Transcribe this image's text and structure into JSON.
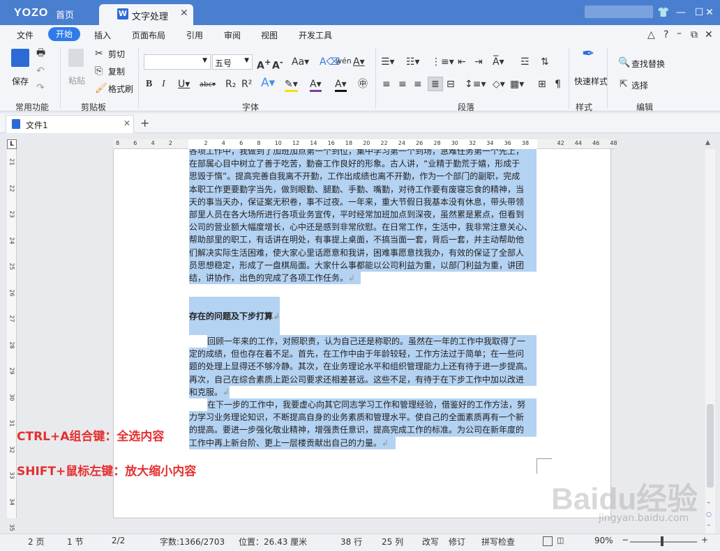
{
  "titlebar": {
    "logo": "YOZO",
    "home": "首页",
    "doc_tab": "文字处理",
    "doc_tab_icon": "W"
  },
  "menubar": [
    "文件",
    "开始",
    "插入",
    "页面布局",
    "引用",
    "审阅",
    "视图",
    "开发工具"
  ],
  "ribbon": {
    "common": {
      "save": "保存",
      "group": "常用功能"
    },
    "clipboard": {
      "paste": "粘贴",
      "cut": "剪切",
      "copy": "复制",
      "format_painter": "格式刷",
      "group": "剪贴板"
    },
    "font": {
      "font_name": "",
      "font_size": "五号",
      "group": "字体"
    },
    "paragraph": {
      "group": "段落"
    },
    "style": {
      "quick_style": "快速样式",
      "group": "样式"
    },
    "edit": {
      "find_replace": "查找替换",
      "select": "选择",
      "group": "编辑"
    }
  },
  "doc_tabs": {
    "tab1": "文件1",
    "add": "+"
  },
  "ruler": {
    "h_ticks": [
      "8",
      "6",
      "4",
      "2",
      "",
      "2",
      "4",
      "6",
      "8",
      "10",
      "12",
      "14",
      "16",
      "18",
      "20",
      "22",
      "24",
      "26",
      "28",
      "30",
      "32",
      "34",
      "36",
      "38",
      "",
      "42",
      "44",
      "46",
      "48"
    ],
    "v_ticks": [
      "21",
      "22",
      "23",
      "24",
      "25",
      "26",
      "27",
      "28",
      "29",
      "30",
      "31",
      "32",
      "33",
      "34",
      "35"
    ]
  },
  "document": {
    "lines": [
      "各项工作中，我做到了加班加点第一个到位，集中学习第一个到场，急难任务第一个先上，",
      "在部属心目中树立了善于吃苦，勤奋工作良好的形象。古人讲，“业精于勤荒于嬉，形成于",
      "思毁于惰”。提高完善自我离不开勤，工作出成绩也离不开勤，作为一个部门的副职，完成",
      "本职工作更要勤字当先，做到眼勤、腿勤、手勤、嘴勤，对待工作要有废寝忘食的精神，当",
      "天的事当天办，保证案无积卷，事不过夜。一年来，重大节假日我基本没有休息，带头带领",
      "部里人员在各大场所进行各项业务宣传，平时经常加班加点到深夜，虽然累是累点，但看到",
      "公司的营业额大幅度增长，心中还是感到非常欣慰。在日常工作，生活中，我非常注意关心、",
      "帮助部里的职工，有话讲在明处，有事提上桌面，不搞当面一套，背后一套，并主动帮助他",
      "们解决实际生活困难，使大家心里话愿意和我讲，困难事愿意找我办，有效的保证了全部人",
      "员思想稳定，形成了一盘棋局面。大家什么事都能以公司利益为重，以部门利益为重，讲团",
      "结，讲协作，出色的完成了各项工作任务。"
    ],
    "heading": "存在的问题及下步打算",
    "para2": [
      "回顾一年来的工作，对照职责，认为自己还是称职的。虽然在一年的工作中我取得了一",
      "定的成绩，但也存在着不足。首先，在工作中由于年龄较轻，工作方法过于简单；在一些问",
      "题的处理上显得还不够冷静。其次，在业务理论水平和组织管理能力上还有待于进一步提高。",
      "再次，自己在综合素质上距公司要求还相差甚远。这些不足，有待于在下步工作中加以改进",
      "和克服。"
    ],
    "para3": [
      "在下一步的工作中，我要虚心向其它同志学习工作和管理经验，借鉴好的工作方法，努",
      "力学习业务理论知识，不断提高自身的业务素质和管理水平。使自己的全面素质再有一个新",
      "的提高。要进一步强化敬业精神，增强责任意识，提高完成工作的标准。为公司在新年度的",
      "工作中再上新台阶、更上一层楼贡献出自己的力量。"
    ]
  },
  "overlay": {
    "line1": "CTRL+A组合键：全选内容",
    "line2": "SHIFT+鼠标左键：放大缩小内容"
  },
  "statusbar": {
    "page": "2 页",
    "section": "1 节",
    "pages": "2/2",
    "words": "字数:1366/2703",
    "position": "位置：26.43 厘米",
    "row": "38 行",
    "col": "25 列",
    "overwrite": "改写",
    "revise": "修订",
    "spell": "拼写检查",
    "zoom": "90%"
  },
  "watermark": {
    "brand": "Baidu经验",
    "url": "jingyan.baidu.com"
  },
  "colors": {
    "titlebar": "#4a7fd0",
    "accent": "#2f7bea",
    "selection": "#b4d2f2",
    "annotation": "#e53030"
  }
}
